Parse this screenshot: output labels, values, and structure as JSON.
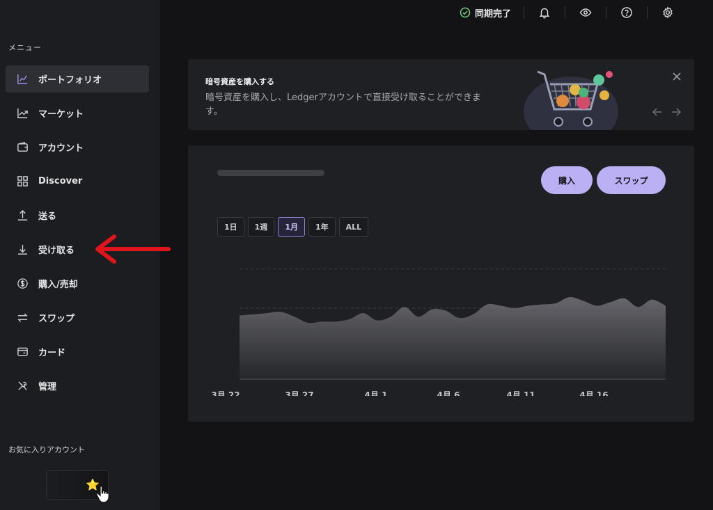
{
  "sidebar": {
    "menu_label": "メニュー",
    "items": [
      {
        "label": "ポートフォリオ",
        "icon": "chart-line-icon",
        "active": true
      },
      {
        "label": "マーケット",
        "icon": "trending-icon"
      },
      {
        "label": "アカウント",
        "icon": "wallet-icon"
      },
      {
        "label": "Discover",
        "icon": "grid-icon"
      },
      {
        "label": "送る",
        "icon": "arrow-up-icon"
      },
      {
        "label": "受け取る",
        "icon": "arrow-down-icon"
      },
      {
        "label": "購入/売却",
        "icon": "dollar-icon"
      },
      {
        "label": "スワップ",
        "icon": "swap-icon"
      },
      {
        "label": "カード",
        "icon": "card-icon"
      },
      {
        "label": "管理",
        "icon": "tools-icon"
      }
    ],
    "favorites_label": "お気に入りアカウント",
    "favorite_star": "⭐"
  },
  "topbar": {
    "sync_status": "同期完了",
    "status_color": "#6ec97a"
  },
  "banner": {
    "title": "暗号資産を購入する",
    "description": "暗号資産を購入し、Ledgerアカウントで直接受け取ることができます。"
  },
  "portfolio": {
    "buy_label": "購入",
    "swap_label": "スワップ",
    "accent": "#bbb0f4",
    "ranges": [
      "1日",
      "1週",
      "1月",
      "1年",
      "ALL"
    ],
    "active_range": "1月"
  },
  "chart_data": {
    "type": "area",
    "x_tick_labels": [
      "3月 22",
      "3月 27",
      "4月 1",
      "4月 6",
      "4月 11",
      "4月 16"
    ],
    "values": [
      52,
      53,
      54,
      55,
      51,
      46,
      47,
      47,
      49,
      54,
      48,
      51,
      59,
      51,
      57,
      56,
      50,
      53,
      61,
      60,
      58,
      60,
      61,
      62,
      67,
      64,
      60,
      63,
      66,
      59,
      65,
      60
    ],
    "ylim": [
      0,
      100
    ],
    "grid": true
  }
}
